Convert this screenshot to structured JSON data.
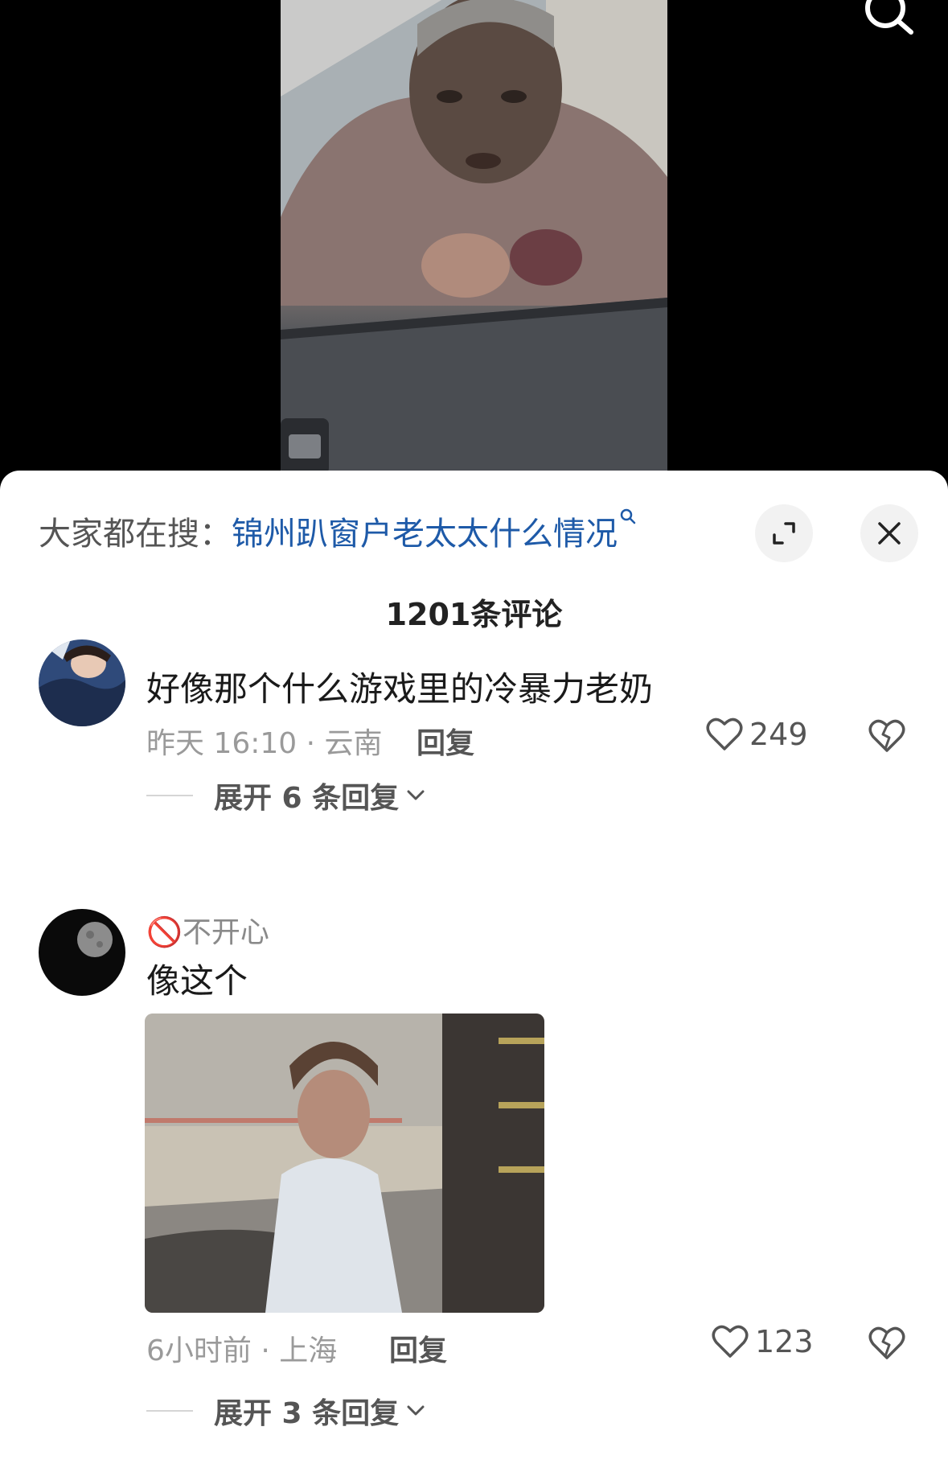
{
  "header": {
    "search_icon": "search-icon"
  },
  "sheet": {
    "search_hint_label": "大家都在搜：",
    "search_hint_query": "锦州趴窗户老太太什么情况",
    "expand_icon": "expand-icon",
    "close_icon": "close-icon",
    "comment_count": "1201条评论"
  },
  "comments": [
    {
      "username": "",
      "text": "好像那个什么游戏里的冷暴力老奶",
      "time_location": "昨天 16:10 · 云南",
      "reply_label": "回复",
      "likes": "249",
      "expand_replies": "展开 6 条回复"
    },
    {
      "username": "🚫不开心",
      "text": "像这个",
      "time_location": "6小时前 · 上海",
      "reply_label": "回复",
      "likes": "123",
      "expand_replies": "展开 3 条回复"
    }
  ],
  "colors": {
    "link": "#1e5aa8",
    "muted": "#9a9a9a",
    "sheet_bg": "#ffffff"
  }
}
